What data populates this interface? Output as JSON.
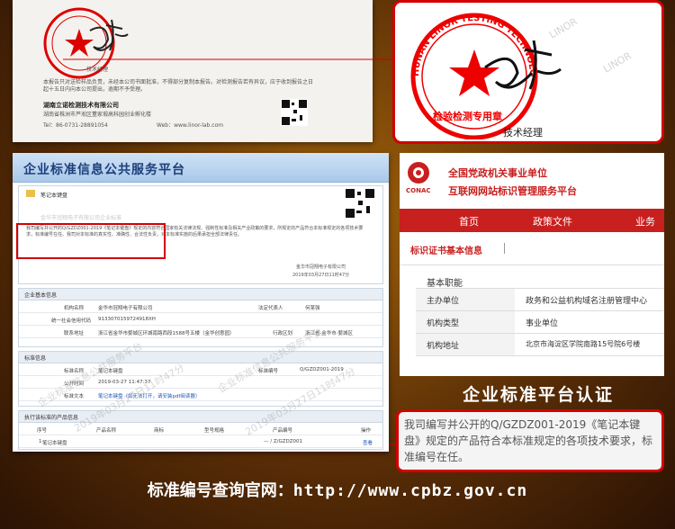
{
  "certificate": {
    "seal_text": "湖南立诺检测技术有限公司",
    "title_label": "技术经理",
    "body_text": "本报告只对送检样品负责，未经本公司书面批准，不得部分复制本报告。对检测报告若有异议，应于收到报告之日起十五日内向本公司提出，逾期不予受理。",
    "company": "湖南立诺检测技术有限公司",
    "address": "湖南省株洲市芦淞区董家塅高科园创业孵化楼",
    "tel": "Tel：86-0731-28891054",
    "web": "Web：www.linor-lab.com",
    "qr_icon": "qr-code-icon"
  },
  "zoom": {
    "seal_lines": [
      "HUNAN LINOR TESTING TECHNOLOGY",
      "湖南立诺检测技术有限公司",
      "检验检测专用章"
    ],
    "title_label": "技术经理",
    "watermark": "LINOR"
  },
  "platform": {
    "header_title": "企业标准信息公共服务平台",
    "doc_label": "笔记本键盘",
    "blurred_company": "金华市冠翔电子有限公司企业标准",
    "statement": "我司编写并公开的Q/GZDZ001-2019《笔记本键盘》规定的内容符合国家有关法律法规、强制性标准及相关产业政策的要求，所规定的产品符合本标准规定的各项技术要求，标准编号在任。我司对本标准的真实性、准确性、合法性负责，对本标准实施的后果承担全部法律责任。",
    "publisher": "金华市冠翔电子有限公司",
    "published": "2019年03月27日11时47分",
    "section_enterprise": "企业基本信息",
    "enterprise_rows": [
      {
        "k1": "机构名称",
        "v1": "金华市冠翔电子有限公司",
        "k2": "法定代表人",
        "v2": "何某强"
      },
      {
        "k1": "统一社会信用代码",
        "v1": "9133070159724918XH",
        "k2": "",
        "v2": ""
      },
      {
        "k1": "联系地址",
        "v1": "浙江省金华市婺城区环城南路西段1588号五楼（金华创意园）",
        "k2": "行政区划",
        "v2": "浙江省·金华市·婺城区"
      }
    ],
    "section_standard": "标准信息",
    "standard_rows": [
      {
        "k1": "标准名称",
        "v1": "笔记本键盘",
        "k2": "标准编号",
        "v2": "Q/GZDZ001-2019"
      },
      {
        "k1": "公开时间",
        "v1": "2019-03-27 11:47:37",
        "k2": "",
        "v2": ""
      },
      {
        "k1": "标准文本",
        "v1": "笔记本键盘（如无法打开，请安装pdf阅读器）",
        "k2": "",
        "v2": ""
      }
    ],
    "section_products": "执行该标准的产品信息",
    "product_cols": [
      "序号",
      "产品名称",
      "商标",
      "型号规格",
      "产品编号",
      "操作"
    ],
    "product_row": [
      "1",
      "笔记本键盘",
      "",
      "",
      "— / Z/GZDZ001",
      "查看"
    ],
    "watermarks": [
      "企业标准信息公共服务平台",
      "2019年03月27日11时47分"
    ],
    "qr_icon": "qr-code-icon"
  },
  "conac": {
    "logo_text": "CONAC",
    "title1": "全国党政机关事业单位",
    "title2": "互联网网站标识管理服务平台",
    "nav": [
      "首页",
      "政策文件",
      "业务"
    ],
    "tab": "标识证书基本信息",
    "section": "基本职能",
    "rows": [
      {
        "k": "主办单位",
        "v": "政务和公益机构域名注册管理中心"
      },
      {
        "k": "机构类型",
        "v": "事业单位"
      },
      {
        "k": "机构地址",
        "v": "北京市海淀区学院南路15号院6号楼"
      }
    ],
    "logo_icon": "conac-logo-icon"
  },
  "captions": {
    "platform_cert": "企业标准平台认证",
    "quote": "我司编写并公开的Q/GZDZ001-2019《笔记本键盘》规定的产品符合本标准规定的各项技术要求，标准编号在任。",
    "query_label": "标准编号查询官网：",
    "query_url": "http://www.cpbz.gov.cn"
  },
  "colors": {
    "accent_red": "#d40000",
    "platform_blue": "#1d3f7a",
    "conac_red": "#c81f1f"
  }
}
